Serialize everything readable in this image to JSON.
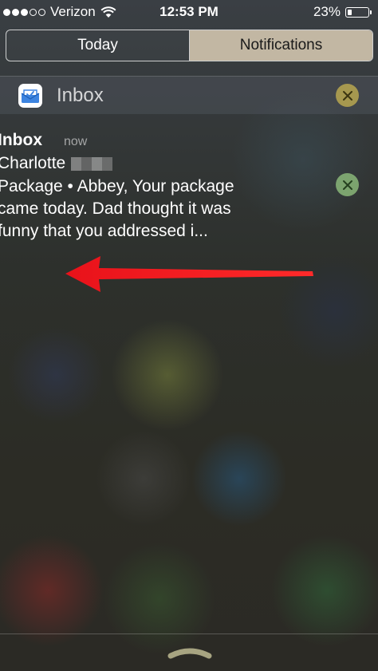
{
  "status_bar": {
    "carrier": "Verizon",
    "time": "12:53 PM",
    "battery_percent_label": "23%",
    "battery_level": 0.23
  },
  "tabs": [
    {
      "label": "Today",
      "selected": false
    },
    {
      "label": "Notifications",
      "selected": true
    }
  ],
  "section": {
    "title": "Inbox",
    "icon": "inbox-envelope-icon"
  },
  "notification": {
    "app": "Inbox",
    "time": "now",
    "sender": "Charlotte",
    "body": "Package  •  Abbey, Your package\ncame today. Dad thought it was\nfunny that you addressed i..."
  },
  "colors": {
    "annotation_arrow": "#e8121a",
    "tab_selected_bg": "#e1d2b9",
    "section_close": "#c8b450",
    "notification_close": "#96c882",
    "inbox_icon_blue": "#3d84e0"
  }
}
